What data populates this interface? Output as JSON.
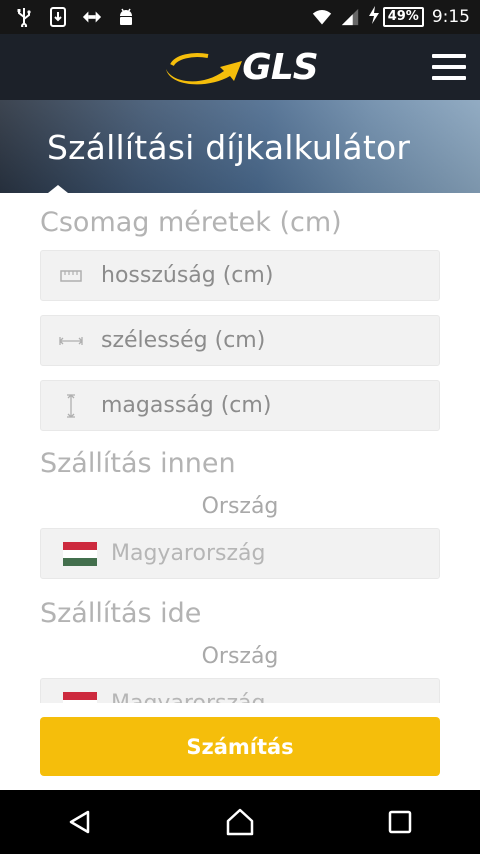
{
  "status_bar": {
    "battery": "49%",
    "time": "9:15",
    "icons": [
      "usb-icon",
      "download-icon",
      "data-sync-icon",
      "android-icon",
      "wifi-icon",
      "signal-icon",
      "charging-icon"
    ]
  },
  "header": {
    "logo_text": "GLS",
    "menu_icon": "hamburger-icon",
    "colors": {
      "background": "#1c2129",
      "logo_swoosh": "#f5be0b"
    }
  },
  "banner": {
    "title": "Szállítási díjkalkulátor"
  },
  "package": {
    "section_title": "Csomag méretek (cm)",
    "length_placeholder": "hosszúság (cm)",
    "width_placeholder": "szélesség (cm)",
    "height_placeholder": "magasság (cm)"
  },
  "from": {
    "section_title": "Szállítás innen",
    "country_label": "Ország",
    "country_value": "Magyarország"
  },
  "to": {
    "section_title": "Szállítás ide",
    "country_label": "Ország",
    "country_value": "Magyarország"
  },
  "actions": {
    "calculate_label": "Számítás",
    "accent_color": "#f5be0b"
  },
  "nav": {
    "icons": [
      "back-icon",
      "home-icon",
      "recents-icon"
    ]
  }
}
